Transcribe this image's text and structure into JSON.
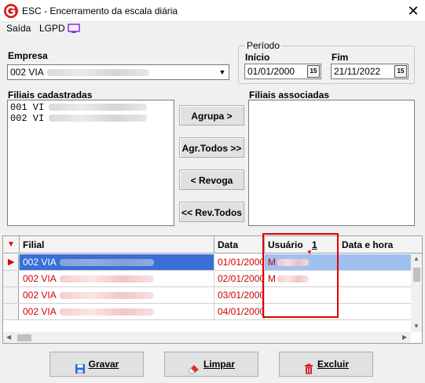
{
  "window": {
    "title": "ESC - Encerramento da escala diária"
  },
  "menu": {
    "items": [
      "Saída",
      "LGPD"
    ]
  },
  "empresa": {
    "label": "Empresa",
    "value_prefix": "002 VIA"
  },
  "periodo": {
    "legend": "Período",
    "inicio_label": "Início",
    "inicio_value": "01/01/2000",
    "fim_label": "Fim",
    "fim_value": "21/11/2022",
    "cal_glyph": "15"
  },
  "filiais_cadastradas": {
    "label": "Filiais cadastradas",
    "items": [
      "001 VI",
      "002 VI"
    ]
  },
  "filiais_associadas": {
    "label": "Filiais associadas"
  },
  "actions": {
    "agrupa": "Agrupa >",
    "agr_todos": "Agr.Todos >>",
    "revoga": "< Revoga",
    "rev_todos": "<< Rev.Todos"
  },
  "grid": {
    "columns": [
      "Filial",
      "Data",
      "Usuário",
      "Data e hora"
    ],
    "sort_indicator": "1",
    "rows": [
      {
        "filial": "002 VIA",
        "data": "01/01/2000",
        "usuario": "M"
      },
      {
        "filial": "002 VIA",
        "data": "02/01/2000",
        "usuario": "M"
      },
      {
        "filial": "002 VIA",
        "data": "03/01/2000",
        "usuario": ""
      },
      {
        "filial": "002 VIA",
        "data": "04/01/2000",
        "usuario": ""
      }
    ]
  },
  "footer": {
    "gravar": "Gravar",
    "limpar": "Limpar",
    "excluir": "Excluir"
  },
  "colors": {
    "accent_red": "#e00000",
    "row_text": "#d00000",
    "selection": "#3a6fd8"
  }
}
